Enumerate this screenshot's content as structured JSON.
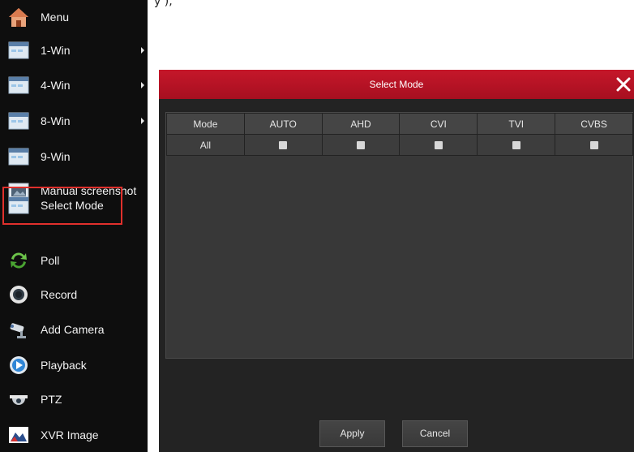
{
  "caption": "y       ),       ",
  "sidebar": {
    "items": [
      {
        "label": "Menu",
        "icon": "home-icon",
        "submenu": false
      },
      {
        "label": "1-Win",
        "icon": "window-icon",
        "submenu": true
      },
      {
        "label": "4-Win",
        "icon": "window-icon",
        "submenu": true
      },
      {
        "label": "8-Win",
        "icon": "window-icon",
        "submenu": true
      },
      {
        "label": "9-Win",
        "icon": "window-icon",
        "submenu": false
      },
      {
        "label": "Manual screenshot",
        "icon": "screenshot-icon",
        "submenu": false
      },
      {
        "label": "Select Mode",
        "icon": "window-icon",
        "submenu": false,
        "highlighted": true
      },
      {
        "label": "Poll",
        "icon": "refresh-icon",
        "submenu": false
      },
      {
        "label": "Record",
        "icon": "record-icon",
        "submenu": false
      },
      {
        "label": "Add Camera",
        "icon": "camera-icon",
        "submenu": false
      },
      {
        "label": "Playback",
        "icon": "playback-icon",
        "submenu": false
      },
      {
        "label": "PTZ",
        "icon": "dome-camera-icon",
        "submenu": false
      },
      {
        "label": "XVR Image",
        "icon": "image-icon",
        "submenu": false
      }
    ]
  },
  "dialog": {
    "title": "Select Mode",
    "close_icon": "close-icon",
    "table": {
      "headers": [
        "Mode",
        "AUTO",
        "AHD",
        "CVI",
        "TVI",
        "CVBS"
      ],
      "rows": [
        {
          "label": "All",
          "checked": [
            false,
            false,
            false,
            false,
            false
          ]
        }
      ]
    },
    "apply_label": "Apply",
    "cancel_label": "Cancel"
  },
  "colors": {
    "header_red": "#b5132a",
    "highlight_border": "#e0302c",
    "sidebar_bg": "#0e0e0e",
    "dialog_bg": "#232323"
  }
}
